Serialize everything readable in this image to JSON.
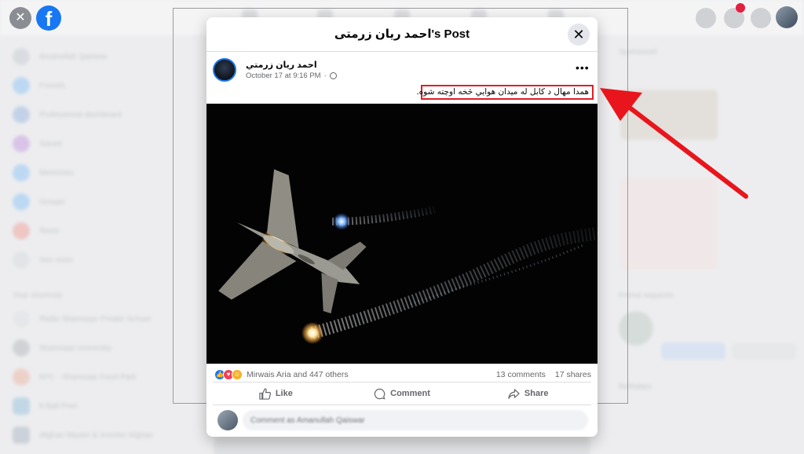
{
  "dialog": {
    "title": "احمد ریان زرمتی's Post",
    "close_symbol": "✕"
  },
  "post": {
    "author": "احمد ريان زرمتي",
    "timestamp": "October 17 at 9:16 PM",
    "more_symbol": "•••",
    "caption": "همدا مهال د کابل له میدان هوايي څخه اوچته شوه.",
    "reactions_text": "Mirwais Aria and 447 others",
    "comments_count": "13 comments",
    "shares_count": "17 shares",
    "actions": {
      "like": "Like",
      "comment": "Comment",
      "share": "Share"
    },
    "comment_placeholder": "Comment as Amanullah Qaiswar"
  },
  "background": {
    "sidebar_items": [
      "Amanullah Qaiswar",
      "Friends",
      "Professional dashboard",
      "Saved",
      "Memories",
      "Groups",
      "Reels",
      "See more"
    ],
    "shortcuts_heading": "Your shortcuts",
    "shortcut_items": [
      "Radio Shamsaar Private School",
      "Shamsaar University",
      "KFC - Shamsaar Food Park",
      "8 Ball Pool",
      "Afghan Master & Inverter Afghan"
    ],
    "right_heading": "Sponsored",
    "friend_requests_heading": "Friend requests",
    "birthdays_heading": "Birthdays"
  },
  "colors": {
    "brand": "#1877f2",
    "highlight_border": "#e01f26",
    "arrow": "#e8161c"
  },
  "icons": [
    "facebook-logo-icon",
    "close-icon",
    "more-icon",
    "globe-icon",
    "like-icon",
    "comment-icon",
    "share-icon",
    "arrow-annotation"
  ]
}
